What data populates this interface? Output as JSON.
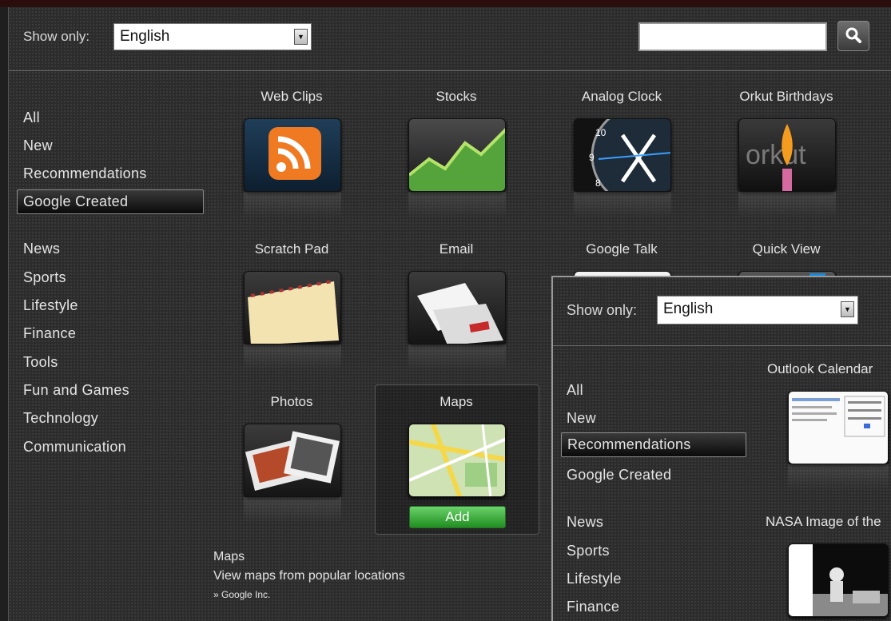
{
  "filter": {
    "label": "Show only:",
    "value": "English"
  },
  "search": {
    "value": ""
  },
  "categories": [
    "All",
    "New",
    "Recommendations",
    "Google Created",
    "News",
    "Sports",
    "Lifestyle",
    "Finance",
    "Tools",
    "Fun and Games",
    "Technology",
    "Communication"
  ],
  "selected_category": "Google Created",
  "gadgets": [
    {
      "title": "Web Clips",
      "icon": "rss-feed-icon"
    },
    {
      "title": "Stocks",
      "icon": "stock-chart-icon"
    },
    {
      "title": "Analog Clock",
      "icon": "analog-clock-icon"
    },
    {
      "title": "Orkut Birthdays",
      "icon": "birthday-candle-icon"
    },
    {
      "title": "Scratch Pad",
      "icon": "notepad-icon"
    },
    {
      "title": "Email",
      "icon": "envelope-icon"
    },
    {
      "title": "Google Talk",
      "icon": "chat-icon"
    },
    {
      "title": "Quick View",
      "icon": "quick-view-icon"
    },
    {
      "title": "Photos",
      "icon": "photo-stack-icon"
    },
    {
      "title": "Maps",
      "icon": "map-icon"
    }
  ],
  "add_label": "Add",
  "detail": {
    "title": "Maps",
    "description": "View maps from popular locations",
    "author": "» Google Inc."
  },
  "secondary": {
    "filter": {
      "label": "Show only:",
      "value": "English"
    },
    "categories": [
      "All",
      "New",
      "Recommendations",
      "Google Created",
      "News",
      "Sports",
      "Lifestyle",
      "Finance"
    ],
    "selected_category": "Recommendations",
    "gadgets": [
      {
        "title": "Outlook Calendar",
        "icon": "calendar-icon"
      },
      {
        "title": "NASA Image of the",
        "icon": "astronaut-photo-icon"
      }
    ]
  },
  "colors": {
    "background": "#2c2c2c",
    "add_button": "#2ea02e",
    "rss_orange": "#ef7a22",
    "selection": "#0a0a0a"
  }
}
